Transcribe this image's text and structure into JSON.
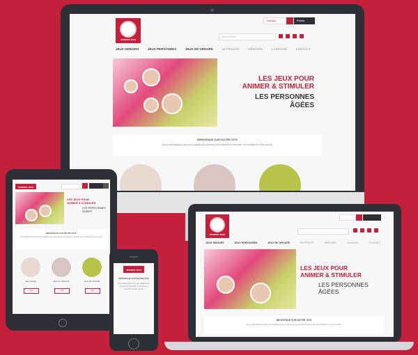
{
  "site": {
    "logo_text": "SENIORS JEUX",
    "nav": [
      "JEUX SENIORS",
      "JEUX PERSONNES",
      "JEUX DE GROUPE",
      "MOTRICITÉ",
      "MÉMOIRE",
      "LANGAGE",
      "CONTACT"
    ],
    "header_links": [
      "Contact",
      "Panier"
    ],
    "search_placeholder": "Rechercher",
    "hero_title_1": "LES JEUX POUR",
    "hero_title_2": "ANIMER & STIMULER",
    "hero_sub_1": "LES PERSONNES",
    "hero_sub_2": "ÂGÉES",
    "welcome_title": "BIENVENUE SUR NOTRE SITE",
    "welcome_text": "Nous développons des jeux adaptés aux seniors pour stimuler la mémoire, la motricité et le lien social.",
    "categories": [
      "Jeux d'éveil",
      "Jeux de mémoire",
      "Jeux de motricité"
    ],
    "cat_button": "Voir"
  },
  "colors": {
    "brand": "#c5203b",
    "device": "#2d2f36"
  },
  "icons": [
    "search-icon",
    "cart-icon",
    "user-icon",
    "menu-icon"
  ]
}
